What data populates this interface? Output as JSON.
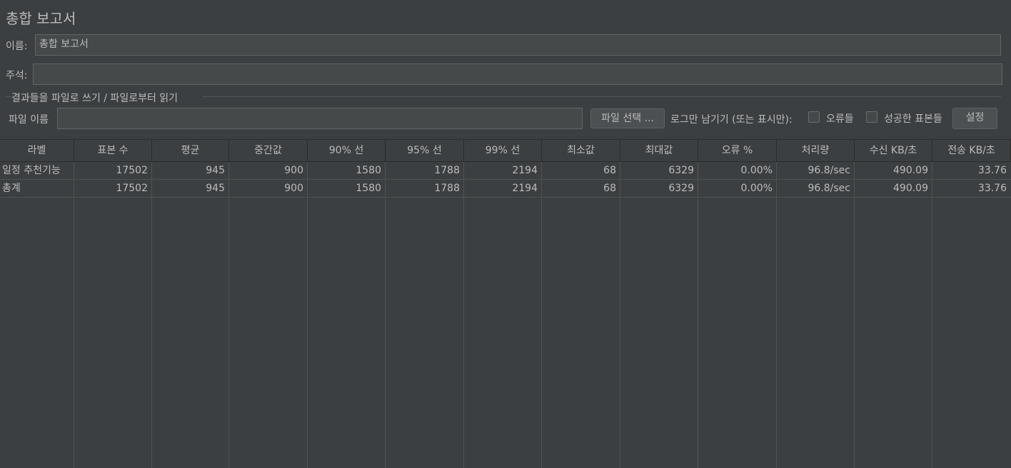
{
  "page": {
    "title": "총합 보고서",
    "name_label": "이름:",
    "name_value": "총합 보고서",
    "comment_label": "주석:",
    "comment_value": ""
  },
  "file_section": {
    "legend": "결과들을 파일로 쓰기 / 파일로부터 읽기",
    "file_name_label": "파일 이름",
    "file_name_value": "",
    "browse_button": "파일 선택 ...",
    "log_only_label": "로그만 남기기 (또는 표시만):",
    "errors_checkbox_label": "오류들",
    "errors_checked": false,
    "success_checkbox_label": "성공한 표본들",
    "success_checked": false,
    "settings_button": "설정"
  },
  "table": {
    "columns": [
      "라벨",
      "표본 수",
      "평균",
      "중간값",
      "90% 선",
      "95% 선",
      "99% 선",
      "최소값",
      "최대값",
      "오류 %",
      "처리량",
      "수신 KB/초",
      "전송 KB/초"
    ],
    "rows": [
      [
        "일정 추천기능",
        "17502",
        "945",
        "900",
        "1580",
        "1788",
        "2194",
        "68",
        "6329",
        "0.00%",
        "96.8/sec",
        "490.09",
        "33.76"
      ],
      [
        "총계",
        "17502",
        "945",
        "900",
        "1580",
        "1788",
        "2194",
        "68",
        "6329",
        "0.00%",
        "96.8/sec",
        "490.09",
        "33.76"
      ]
    ]
  },
  "colors": {
    "background": "#3c3f41",
    "text": "#bbbbbb",
    "field_background": "#45494a",
    "grid_line": "#515151"
  }
}
